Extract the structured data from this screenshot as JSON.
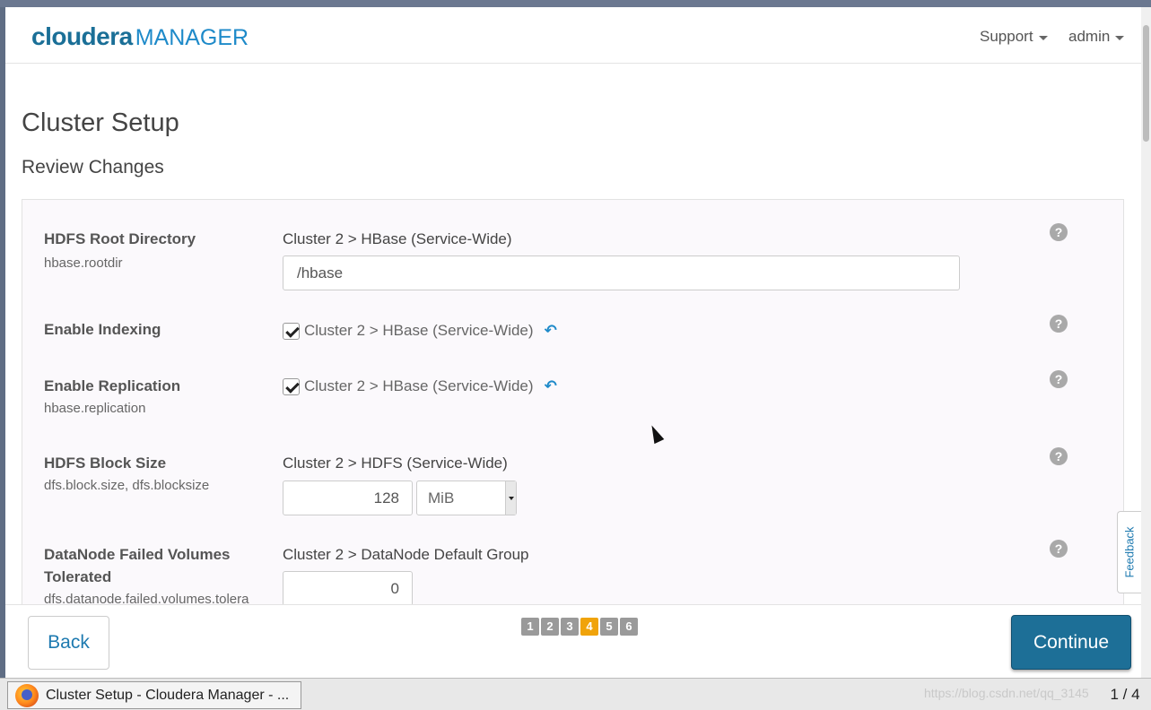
{
  "header": {
    "logo_brand": "cloudera",
    "logo_product": "MANAGER",
    "support_label": "Support",
    "admin_label": "admin"
  },
  "page": {
    "title": "Cluster Setup",
    "subtitle": "Review Changes"
  },
  "rows": [
    {
      "label": "HDFS Root Directory",
      "property": "hbase.rootdir",
      "scope": "Cluster 2 > HBase (Service-Wide)",
      "value": "/hbase"
    },
    {
      "label": "Enable Indexing",
      "property": "",
      "scope": "Cluster 2 > HBase (Service-Wide)",
      "checked": true
    },
    {
      "label": "Enable Replication",
      "property": "hbase.replication",
      "scope": "Cluster 2 > HBase (Service-Wide)",
      "checked": true
    },
    {
      "label": "HDFS Block Size",
      "property": "dfs.block.size, dfs.blocksize",
      "scope": "Cluster 2 > HDFS (Service-Wide)",
      "value": "128",
      "unit": "MiB"
    },
    {
      "label_line1": "DataNode Failed Volumes",
      "label_line2": "Tolerated",
      "property": "dfs.datanode.failed.volumes.tolera",
      "scope": "Cluster 2 > DataNode Default Group",
      "value": "0"
    }
  ],
  "help_glyph": "?",
  "undo_glyph": "↶",
  "footer": {
    "back_label": "Back",
    "continue_label": "Continue",
    "steps": [
      "1",
      "2",
      "3",
      "4",
      "5",
      "6"
    ],
    "current_step": 4
  },
  "feedback_label": "Feedback",
  "taskbar": {
    "window_title": "Cluster Setup - Cloudera Manager - ...",
    "watermark": "https://blog.csdn.net/qq_3145",
    "page_counter": "1 / 4"
  },
  "colors": {
    "brand": "#1a6f97",
    "link": "#1e8ac9",
    "continue_bg": "#1d6f97",
    "active_step": "#f0a30a"
  }
}
